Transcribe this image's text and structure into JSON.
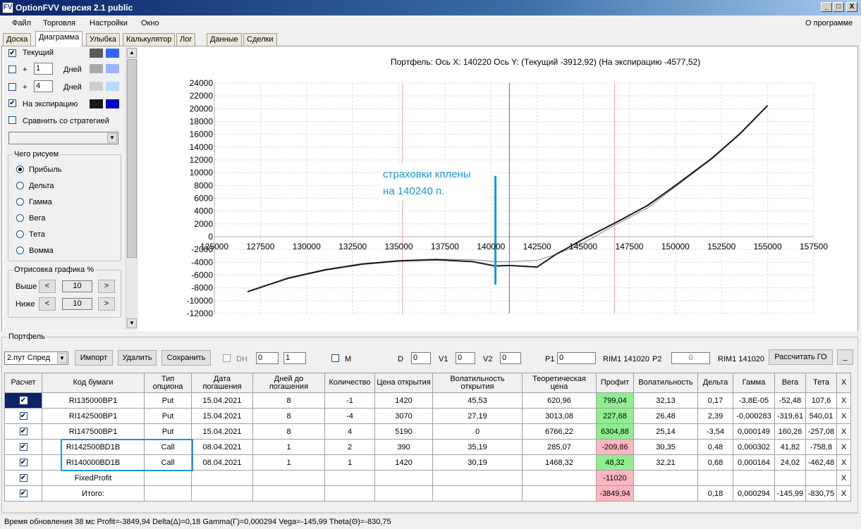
{
  "window": {
    "title": "OptionFVV версия 2.1 public",
    "icon_glyph": "FV",
    "min": "_",
    "max": "□",
    "close": "X"
  },
  "menu": {
    "items": [
      "Файл",
      "Торговля",
      "Настройки",
      "Окно"
    ],
    "about": "О программе"
  },
  "tabs": [
    "Доска",
    "Диаграмма",
    "Улыбка",
    "Калькулятор",
    "Лог",
    "Данные",
    "Сделки"
  ],
  "left": {
    "rows": [
      {
        "checked": true,
        "label": "Текущий",
        "c1": "#5a5a5a",
        "c2": "#3366ff"
      },
      {
        "checked": false,
        "plus": "+",
        "days": "1",
        "label": "Дней",
        "c1": "#a9a9a9",
        "c2": "#99b3ff"
      },
      {
        "checked": false,
        "plus": "+",
        "days": "4",
        "label": "Дней",
        "c1": "#cfcfcf",
        "c2": "#b3dcff"
      },
      {
        "checked": true,
        "label": "На экспирацию",
        "c1": "#1a1a1a",
        "c2": "#0000cc"
      }
    ],
    "compare": "Сравнить со стратегией",
    "draw_group": "Чего рисуем",
    "radios": [
      "Прибыль",
      "Дельта",
      "Гамма",
      "Вега",
      "Тета",
      "Вомма"
    ],
    "render_group": "Отрисовка графика %",
    "above_label": "Выше",
    "above_val": "10",
    "below_label": "Ниже",
    "below_val": "10",
    "prev": "<",
    "next": ">"
  },
  "chart_header": "Портфель: Ось X: 140220 Ось Y: (Текущий -3912,92) (На экспирацию -4577,52)",
  "annotation": {
    "line1": "страховки кплены",
    "line2": "на 140240 п."
  },
  "chart_data": {
    "type": "line",
    "xlim": [
      125000,
      157500
    ],
    "ylim": [
      -12000,
      24000
    ],
    "xticks": [
      "125000",
      "127500",
      "130000",
      "132500",
      "135000",
      "137500",
      "140000",
      "142500",
      "145000",
      "147500",
      "150000",
      "152500",
      "155000",
      "157500"
    ],
    "yticks": [
      "24000",
      "22000",
      "20000",
      "18000",
      "16000",
      "14000",
      "12000",
      "10000",
      "8000",
      "6000",
      "4000",
      "2000",
      "0",
      "-2000",
      "-4000",
      "-6000",
      "-8000",
      "-10000",
      "-12000"
    ],
    "vlines": [
      {
        "x": 135200,
        "color": "#ff9999"
      },
      {
        "x": 141000,
        "color": "#6666cc"
      },
      {
        "x": 146700,
        "color": "#ff9999"
      },
      {
        "x": 140240,
        "color": "#1a96d4"
      }
    ],
    "series": [
      {
        "color": "#808080",
        "width": 1,
        "x": [
          126800,
          129000,
          131000,
          133000,
          135000,
          137000,
          139000,
          140200,
          141000,
          142500,
          143500,
          145000,
          146700,
          148500,
          150000,
          152000,
          153500,
          155000
        ],
        "y": [
          -8600,
          -6400,
          -5100,
          -4200,
          -3700,
          -3500,
          -3600,
          -3900,
          -3900,
          -3700,
          -2800,
          -1000,
          1800,
          4500,
          7800,
          12200,
          16000,
          20500
        ]
      },
      {
        "color": "#1a1a1a",
        "width": 2,
        "x": [
          126800,
          129000,
          131000,
          133000,
          135000,
          137000,
          139000,
          140220,
          141000,
          142500,
          143500,
          145000,
          146700,
          148500,
          150000,
          152000,
          153500,
          155000
        ],
        "y": [
          -8600,
          -6500,
          -5200,
          -4300,
          -3800,
          -3600,
          -3900,
          -4580,
          -4500,
          -4750,
          -2800,
          -400,
          2100,
          4900,
          8000,
          12300,
          16100,
          20500
        ]
      }
    ]
  },
  "portfolio": {
    "group": "Портфель",
    "select": "2.пут Спред",
    "import": "Импорт",
    "delete": "Удалить",
    "save": "Сохранить",
    "dh": "DH",
    "dh1": "0",
    "dh2": "1",
    "m": "M",
    "d_label": "D",
    "d_val": "0",
    "v1_label": "V1",
    "v1_val": "0",
    "v2_label": "V2",
    "v2_val": "0",
    "p1_label": "P1",
    "p1_val": "0",
    "p1_sec": "RIM1 141020",
    "p2_label": "P2",
    "p2_val": "0",
    "p2_sec": "RIM1 141020",
    "calc": "Рассчитать ГО",
    "extra": "_"
  },
  "grid": {
    "headers": [
      "Расчет",
      "Код бумаги",
      "Тип опциона",
      "Дата погашения",
      "Дней до погашения",
      "Количество",
      "Цена открытия",
      "Волатильность открытия",
      "Теоретическая цена",
      "Профит",
      "Волатильность",
      "Дельта",
      "Гамма",
      "Вега",
      "Тета",
      "X"
    ],
    "rows": [
      [
        "✔",
        "RI135000BP1",
        "Put",
        "15.04.2021",
        "8",
        "-1",
        "1420",
        "45,53",
        "620,96",
        "799,04",
        "32,13",
        "0,17",
        "-3,8E-05",
        "-52,48",
        "107,6",
        "X"
      ],
      [
        "✔",
        "RI142500BP1",
        "Put",
        "15.04.2021",
        "8",
        "-4",
        "3070",
        "27,19",
        "3013,08",
        "227,68",
        "26,48",
        "2,39",
        "-0,000283",
        "-319,61",
        "540,01",
        "X"
      ],
      [
        "✔",
        "RI147500BP1",
        "Put",
        "15.04.2021",
        "8",
        "4",
        "5190",
        "0",
        "6766,22",
        "6304,88",
        "25,14",
        "-3,54",
        "0,000149",
        "160,26",
        "-257,08",
        "X"
      ],
      [
        "✔",
        "RI142500BD1B",
        "Call",
        "08.04.2021",
        "1",
        "2",
        "390",
        "35,19",
        "285,07",
        "-209,86",
        "30,35",
        "0,48",
        "0,000302",
        "41,82",
        "-758,8",
        "X"
      ],
      [
        "✔",
        "RI140000BD1B",
        "Call",
        "08.04.2021",
        "1",
        "1",
        "1420",
        "30,19",
        "1468,32",
        "48,32",
        "32,21",
        "0,68",
        "0,000164",
        "24,02",
        "-462,48",
        "X"
      ],
      [
        "✔",
        "FixedProfit",
        "",
        "",
        "",
        "",
        "",
        "",
        "",
        "-11020",
        "",
        "",
        "",
        "",
        "",
        "X"
      ],
      [
        "✔",
        "Итого:",
        "",
        "",
        "",
        "",
        "",
        "",
        "",
        "-3849,94",
        "",
        "0,18",
        "0,000294",
        "-145,99",
        "-830,75",
        "X"
      ]
    ],
    "profit_colors": [
      "green",
      "green",
      "green",
      "pink",
      "green",
      "pink",
      "pink"
    ]
  },
  "status": "Время обновления 38 мс  Profit=-3849,94 Delta(Δ)=0,18 Gamma(Γ)=0,000294 Vega=-145,99 Theta(Θ)=-830,75"
}
